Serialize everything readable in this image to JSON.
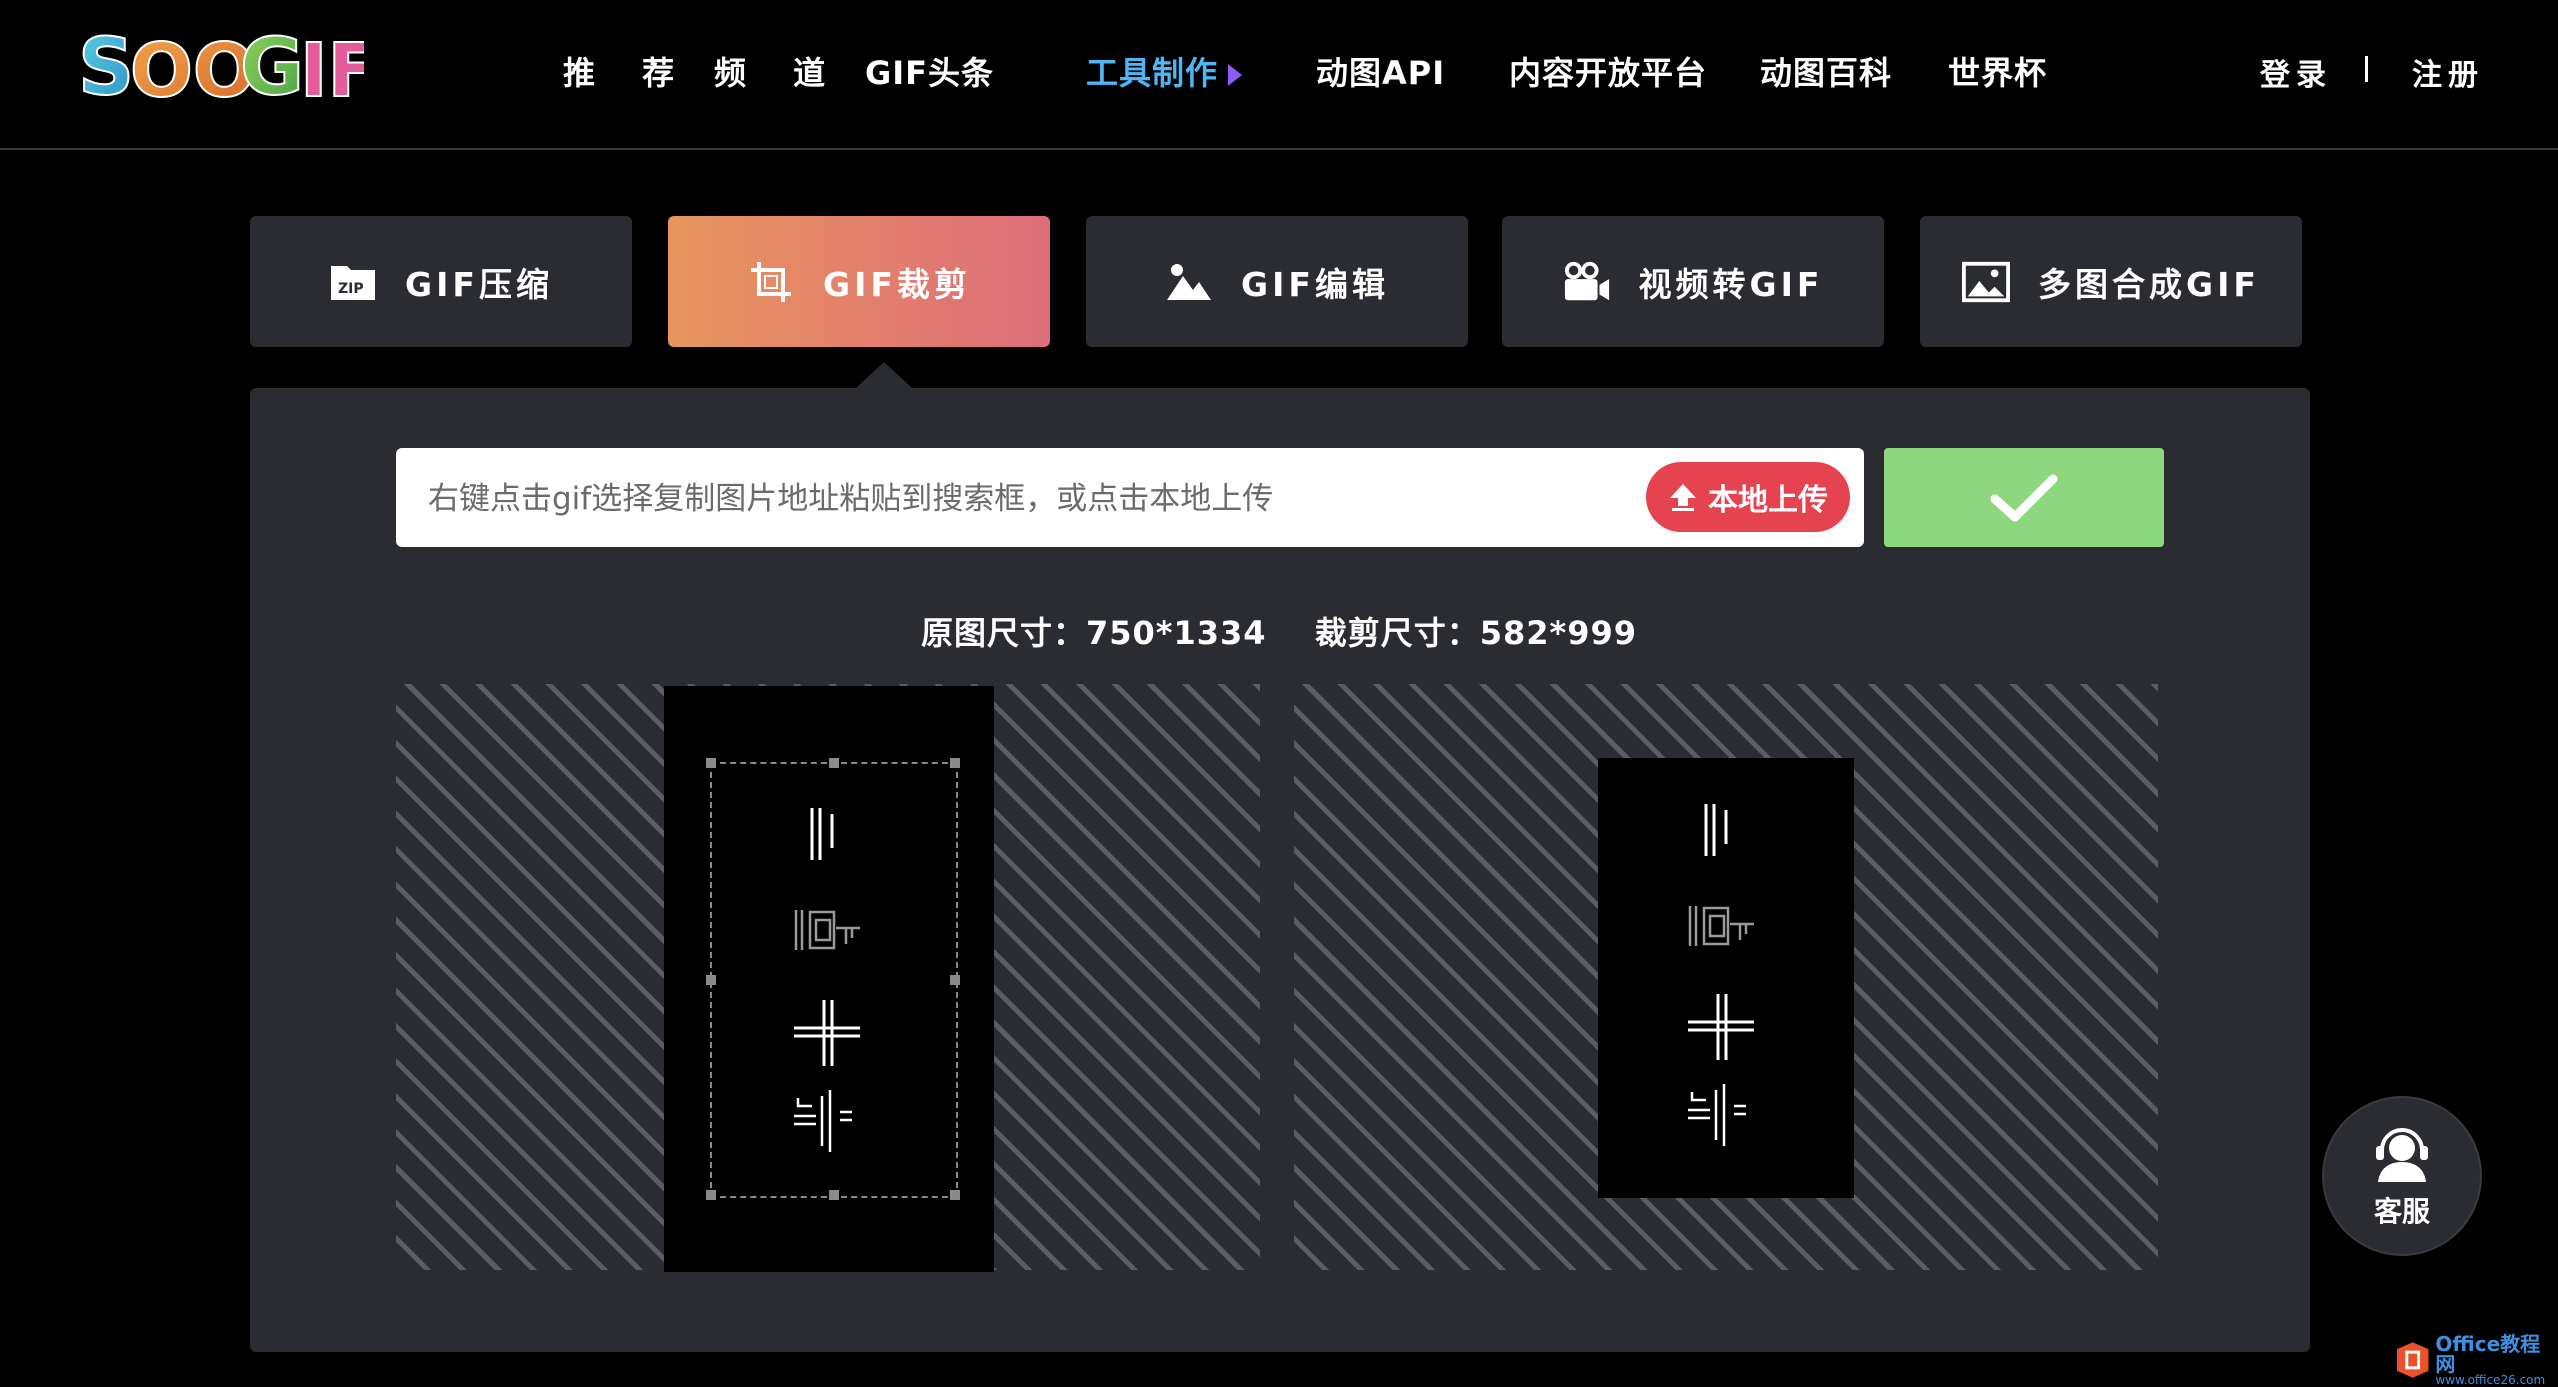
{
  "brand": {
    "logo_text": "SOOGIF"
  },
  "nav": {
    "items": [
      {
        "label": "推 荐"
      },
      {
        "label": "频 道"
      },
      {
        "label": "GIF头条"
      },
      {
        "label": "工具制作"
      },
      {
        "label": "动图API"
      },
      {
        "label": "内容开放平台"
      },
      {
        "label": "动图百科"
      },
      {
        "label": "世界杯"
      }
    ],
    "active_index": 3,
    "login": "登录",
    "register": "注册"
  },
  "tools": [
    {
      "label": "GIF压缩",
      "icon": "zip-icon",
      "active": false
    },
    {
      "label": "GIF裁剪",
      "icon": "crop-icon",
      "active": true
    },
    {
      "label": "GIF编辑",
      "icon": "mountain-image-icon",
      "active": false
    },
    {
      "label": "视频转GIF",
      "icon": "video-camera-icon",
      "active": false
    },
    {
      "label": "多图合成GIF",
      "icon": "picture-icon",
      "active": false
    }
  ],
  "url_input": {
    "placeholder": "右键点击gif选择复制图片地址粘贴到搜索框，或点击本地上传",
    "value": ""
  },
  "upload_button": {
    "label": "本地上传",
    "icon": "upload-arrow-icon"
  },
  "confirm_button": {
    "icon": "checkmark-icon"
  },
  "size_info": {
    "original": "原图尺寸：750*1334",
    "cropped": "裁剪尺寸：582*999"
  },
  "service": {
    "label": "客服",
    "icon": "headset-agent-icon"
  },
  "watermark": {
    "main": "Office教程网",
    "sub": "www.office26.com"
  },
  "colors": {
    "background": "#000000",
    "panel": "#2b2c31",
    "active_nav": "#4fb6f5",
    "active_tab_gradient_start": "#e8955d",
    "active_tab_gradient_end": "#dd6d7a",
    "upload_red": "#e5434f",
    "confirm_green": "#8fd77f"
  }
}
